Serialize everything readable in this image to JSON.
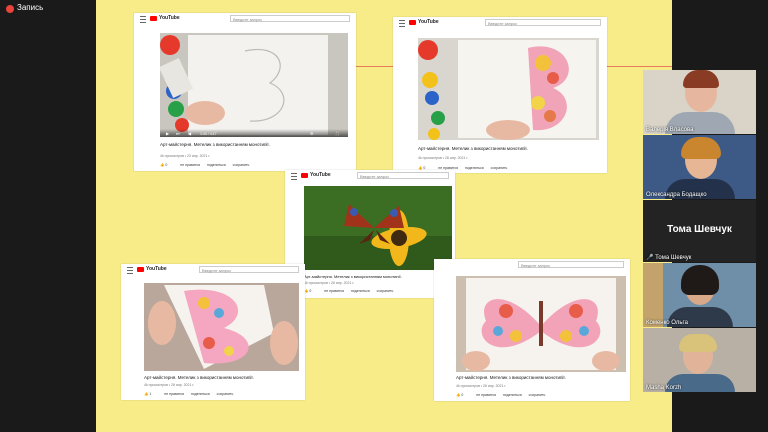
{
  "recording": {
    "label": "Запись"
  },
  "youtube": {
    "wordmark": "YouTube",
    "search_placeholder": "Введите запрос"
  },
  "cards": [
    {
      "title": "Арт-майстерня. Метелик з використанням монотипії.",
      "meta": "4k просмотров • 23 апр. 2021 г.",
      "likes": "0",
      "dislike": "не нравится",
      "share": "поделиться",
      "save": "сохранить",
      "time": "1:40 / 4:17"
    },
    {
      "title": "Арт-майстерня. Метелик з використанням монотипії.",
      "meta": "4k просмотров • 26 апр. 2021 г.",
      "likes": "0",
      "dislike": "не нравится",
      "share": "поделиться",
      "save": "сохранить"
    },
    {
      "title": "Арт-майстерня. Метелик з використанням монотипії.",
      "meta": "4k просмотров • 26 апр. 2021 г.",
      "likes": "0",
      "dislike": "не нравится",
      "share": "поделиться",
      "save": "сохранить"
    },
    {
      "title": "Арт-майстерня. Метелик з використанням монотипії.",
      "meta": "4k просмотров • 26 апр. 2021 г.",
      "likes": "1",
      "dislike": "не нравится",
      "share": "поделиться",
      "save": "сохранить"
    },
    {
      "title": "Арт-майстерня. Метелик з використанням монотипії.",
      "meta": "4k просмотров • 26 апр. 2021 г.",
      "likes": "0",
      "dislike": "не нравится",
      "share": "поделиться",
      "save": "сохранить"
    }
  ],
  "participants": [
    {
      "name": "Валерія Власова"
    },
    {
      "name": "Олександра Бодащко"
    },
    {
      "name": "Тома Шевчук",
      "label": "Тома Шевчук"
    },
    {
      "name": "Коменко Ольга"
    },
    {
      "name": "Masha Korzh"
    }
  ]
}
